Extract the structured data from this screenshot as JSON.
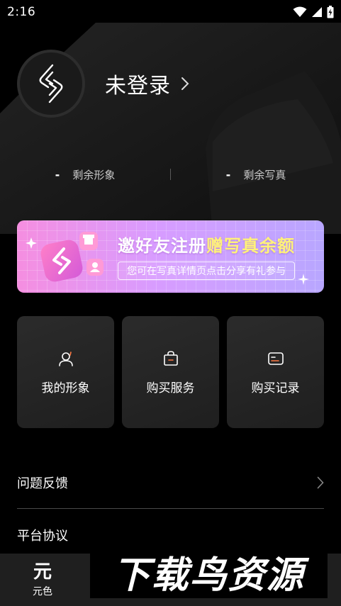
{
  "status_bar": {
    "time": "2:16",
    "icons": [
      "wifi-icon",
      "signal-icon",
      "battery-icon"
    ]
  },
  "profile": {
    "login_text": "未登录",
    "avatar_icon": "app-logo-icon"
  },
  "stats": [
    {
      "value": "-",
      "label": "剩余形象"
    },
    {
      "value": "-",
      "label": "剩余写真"
    }
  ],
  "banner": {
    "title_part1": "邀好友注册",
    "title_part2": "赠写真余额",
    "subtitle": "您可在写真详情页点击分享有礼参与"
  },
  "menu": [
    {
      "label": "我的形象",
      "icon": "user-avatar-icon"
    },
    {
      "label": "购买服务",
      "icon": "shopping-bag-icon"
    },
    {
      "label": "购买记录",
      "icon": "record-card-icon"
    }
  ],
  "list": {
    "feedback_label": "问题反馈",
    "agreement_label": "平台协议"
  },
  "bottom_nav": {
    "tab_glyph": "元",
    "tab_label": "元色"
  },
  "watermark": {
    "text": "下载鸟资源"
  },
  "colors": {
    "background": "#000000",
    "card": "#262626",
    "banner_start": "#f58ee0",
    "banner_end": "#b8a6ff",
    "banner_highlight": "#fff27a"
  }
}
